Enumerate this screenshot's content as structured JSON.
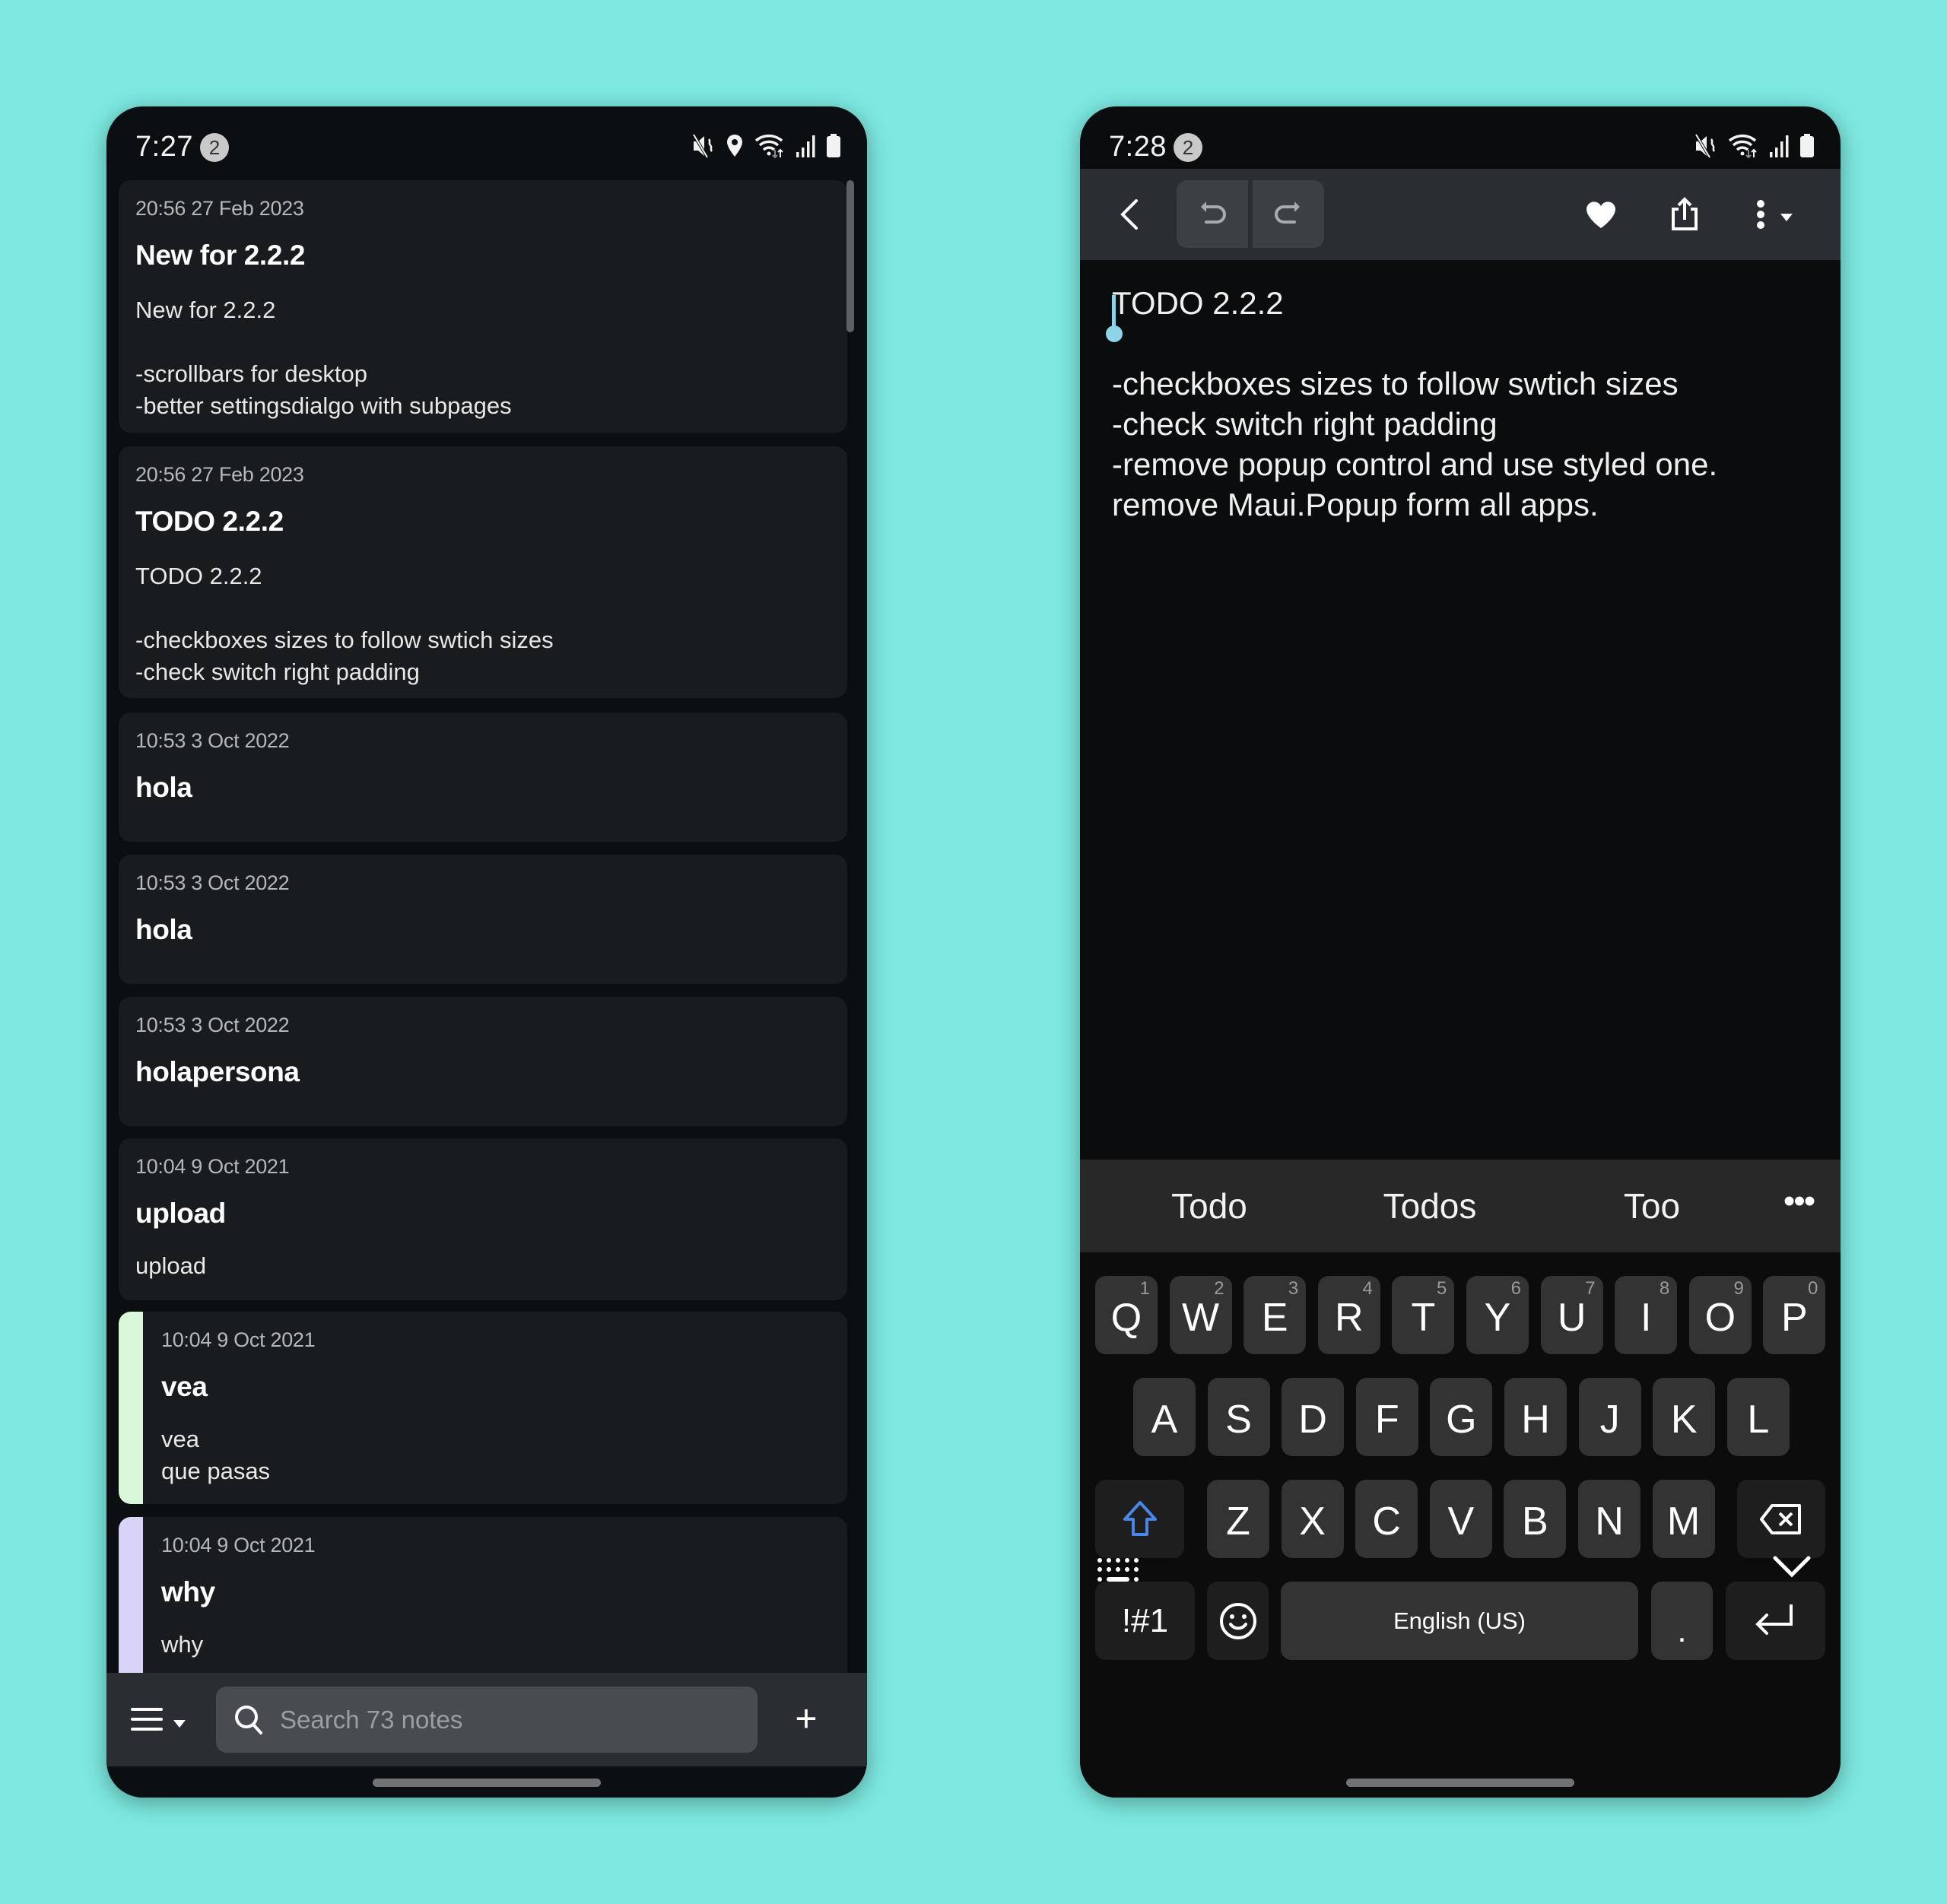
{
  "left_phone": {
    "status": {
      "time": "7:27",
      "notification_count": "2",
      "icons": [
        "mute-icon",
        "location-icon",
        "wifi-icon",
        "signal-icon",
        "battery-icon"
      ]
    },
    "notes": [
      {
        "date": "20:56 27 Feb 2023",
        "title": "New for 2.2.2",
        "body": "New for 2.2.2\n\n-scrollbars for desktop\n-better settingsdialgo with subpages",
        "color": null
      },
      {
        "date": "20:56 27 Feb 2023",
        "title": "TODO 2.2.2",
        "body": "TODO 2.2.2\n\n-checkboxes sizes to follow swtich sizes\n-check switch right padding",
        "color": null
      },
      {
        "date": "10:53 3 Oct 2022",
        "title": "hola",
        "body": "",
        "color": null
      },
      {
        "date": "10:53 3 Oct 2022",
        "title": "hola",
        "body": "",
        "color": null
      },
      {
        "date": "10:53 3 Oct 2022",
        "title": "holapersona",
        "body": "",
        "color": null
      },
      {
        "date": "10:04 9 Oct 2021",
        "title": "upload",
        "body": "upload",
        "color": null
      },
      {
        "date": "10:04 9 Oct 2021",
        "title": "vea",
        "body": "vea\nque pasas",
        "color": "#d9f7d9"
      },
      {
        "date": "10:04 9 Oct 2021",
        "title": "why",
        "body": "why",
        "color": "#d8d3f7"
      }
    ],
    "bottom_bar": {
      "search_placeholder": "Search 73 notes",
      "search_value": "",
      "add_label": "+"
    }
  },
  "right_phone": {
    "status": {
      "time": "7:28",
      "notification_count": "2",
      "icons": [
        "mute-icon",
        "wifi-icon",
        "signal-icon",
        "battery-icon"
      ]
    },
    "toolbar": {
      "buttons": [
        "back",
        "undo",
        "redo",
        "favorite",
        "share",
        "more"
      ]
    },
    "editor": {
      "title_line": "TODO 2.2.2",
      "body": "-checkboxes sizes to follow swtich sizes\n-check switch right padding\n-remove popup control and use styled one.\nremove Maui.Popup form all apps."
    },
    "keyboard": {
      "suggestions": [
        "Todo",
        "Todos",
        "Too"
      ],
      "more_suggestions": "•••",
      "row1": [
        {
          "key": "Q",
          "hint": "1"
        },
        {
          "key": "W",
          "hint": "2"
        },
        {
          "key": "E",
          "hint": "3"
        },
        {
          "key": "R",
          "hint": "4"
        },
        {
          "key": "T",
          "hint": "5"
        },
        {
          "key": "Y",
          "hint": "6"
        },
        {
          "key": "U",
          "hint": "7"
        },
        {
          "key": "I",
          "hint": "8"
        },
        {
          "key": "O",
          "hint": "9"
        },
        {
          "key": "P",
          "hint": "0"
        }
      ],
      "row2": [
        "A",
        "S",
        "D",
        "F",
        "G",
        "H",
        "J",
        "K",
        "L"
      ],
      "row3": [
        "Z",
        "X",
        "C",
        "V",
        "B",
        "N",
        "M"
      ],
      "symbols_label": "!#1",
      "space_label": "English (US)",
      "period_label": ".",
      "shift_color": "#4a86e8"
    }
  },
  "colors": {
    "background": "#7de9e0",
    "cursor": "#8fd3e8"
  }
}
